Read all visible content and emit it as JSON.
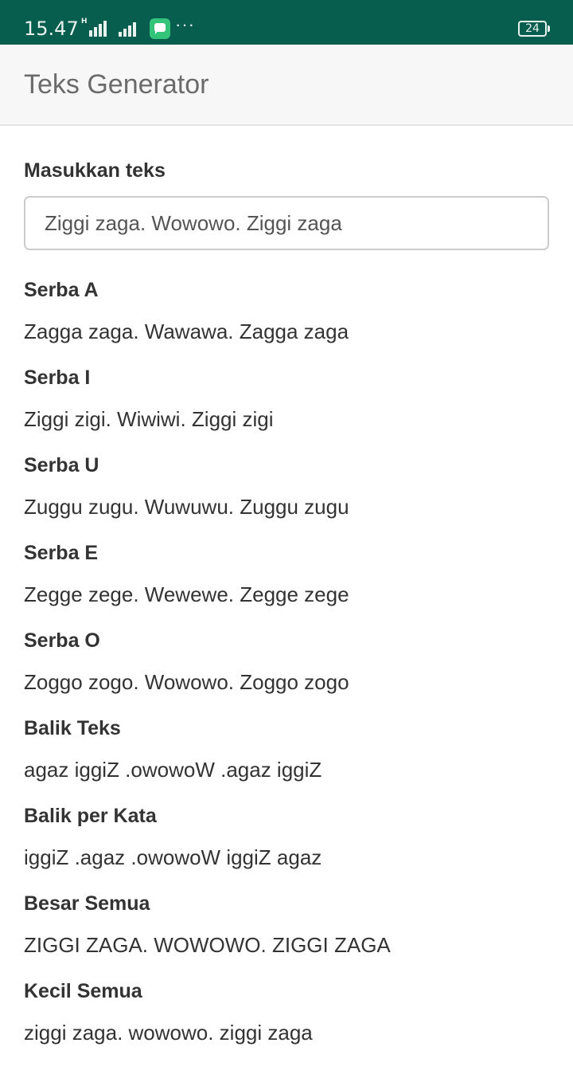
{
  "status_bar": {
    "time": "15.47",
    "network_label": "H",
    "battery": "24",
    "icons": [
      "signal-icon",
      "signal-icon",
      "message-icon",
      "more-icon",
      "battery-icon"
    ],
    "more": "···"
  },
  "header": {
    "title": "Teks Generator"
  },
  "input": {
    "label": "Masukkan teks",
    "value": "Ziggi zaga. Wowowo. Ziggi zaga"
  },
  "results": [
    {
      "label": "Serba A",
      "value": "Zagga zaga. Wawawa. Zagga zaga"
    },
    {
      "label": "Serba I",
      "value": "Ziggi zigi. Wiwiwi. Ziggi zigi"
    },
    {
      "label": "Serba U",
      "value": "Zuggu zugu. Wuwuwu. Zuggu zugu"
    },
    {
      "label": "Serba E",
      "value": "Zegge zege. Wewewe. Zegge zege"
    },
    {
      "label": "Serba O",
      "value": "Zoggo zogo. Wowowo. Zoggo zogo"
    },
    {
      "label": "Balik Teks",
      "value": "agaz iggiZ .owowoW .agaz iggiZ"
    },
    {
      "label": "Balik per Kata",
      "value": "iggiZ .agaz .owowoW iggiZ agaz"
    },
    {
      "label": "Besar Semua",
      "value": "ZIGGI ZAGA. WOWOWO. ZIGGI ZAGA"
    },
    {
      "label": "Kecil Semua",
      "value": "ziggi zaga. wowowo. ziggi zaga"
    }
  ],
  "colors": {
    "status_bar": "#075d4e",
    "header_bg": "#f7f7f7",
    "message_icon": "#33c47a",
    "text": "#333333"
  }
}
